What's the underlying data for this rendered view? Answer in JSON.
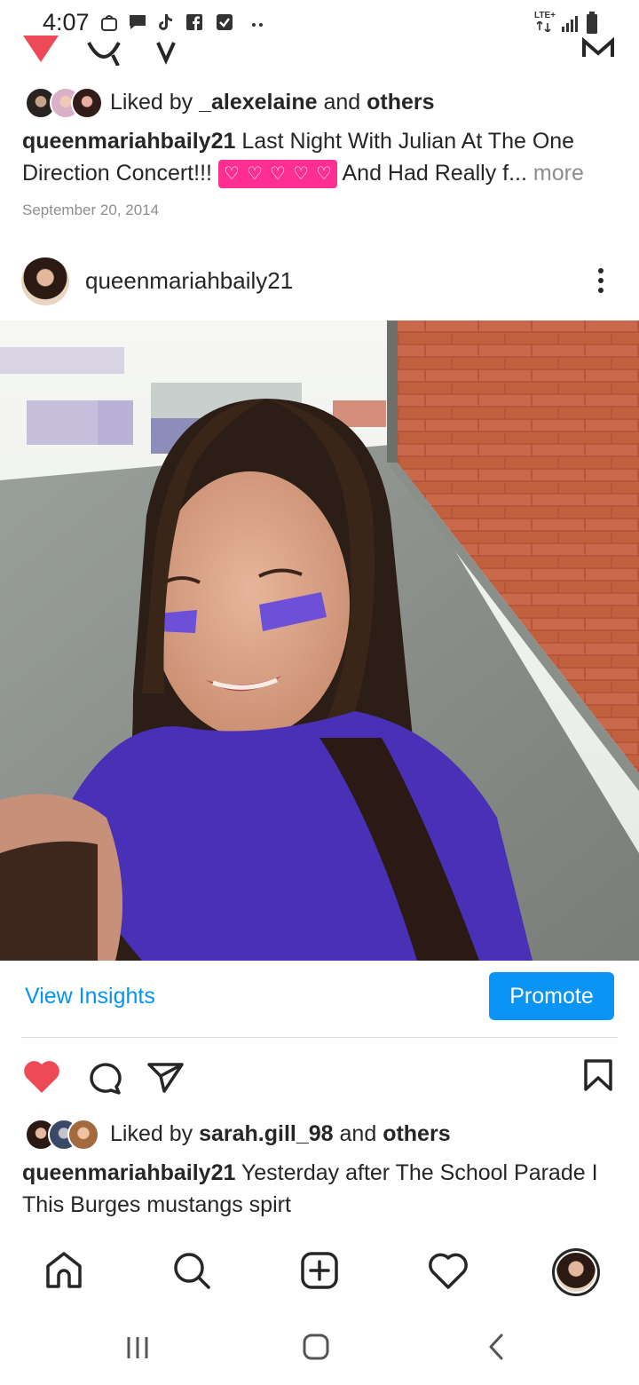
{
  "status_bar": {
    "time": "4:07",
    "network": "LTE+",
    "icons": [
      "bag-icon",
      "message-icon",
      "tiktok-icon",
      "facebook-icon",
      "check-box-icon",
      "more-dots-icon",
      "signal-icon",
      "battery-icon"
    ]
  },
  "post_previous": {
    "liked_by_prefix": "Liked by",
    "liked_by_user": "_alexelaine",
    "liked_by_and": "and",
    "liked_by_others": "others",
    "caption_user": "queenmariahbaily21",
    "caption_text_1": "Last Night With Julian At The One Direction Concert!!!",
    "caption_text_2": "And Had Really f...",
    "more_label": "more",
    "date": "September 20, 2014"
  },
  "post_current": {
    "username": "queenmariahbaily21",
    "photo_alt": "Girl with purple face paint sitting by a brick wall",
    "view_insights_label": "View Insights",
    "promote_label": "Promote",
    "liked_by_prefix": "Liked by",
    "liked_by_user": "sarah.gill_98",
    "liked_by_and": "and",
    "liked_by_others": "others",
    "caption_user": "queenmariahbaily21",
    "caption_text": "Yesterday after The School Parade I This Burges mustangs spirt"
  },
  "bottom_nav": [
    "home-icon",
    "search-icon",
    "new-post-icon",
    "activity-heart-icon",
    "profile-avatar"
  ],
  "system_nav": [
    "recent-apps-button",
    "home-button",
    "back-button"
  ],
  "colors": {
    "like_red": "#ed4956",
    "link_blue": "#0095f6",
    "promote_blue": "#0a95f6",
    "heart_emoji_bg": "#ff2e93"
  }
}
